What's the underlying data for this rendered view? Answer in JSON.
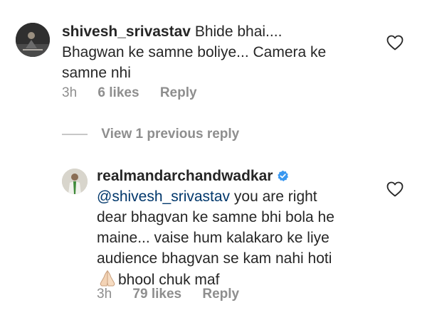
{
  "comments": [
    {
      "username": "shivesh_srivastav",
      "text_line1": "Bhide bhai....",
      "text_line2": "Bhagwan ke samne boliye... Camera ke",
      "text_line3": "samne nhi",
      "time": "3h",
      "likes": "6 likes",
      "reply_label": "Reply",
      "avatar_icon": "user-avatar-dark",
      "liked": false
    },
    {
      "username": "realmandarchandwadkar",
      "verified": true,
      "mention": "@shivesh_srivastav",
      "text_line1": "you are right",
      "text_line2": "dear bhagvan ke samne bhi bola he",
      "text_line3": "maine... vaise hum kalakaro ke liye",
      "text_line4": "audience bhagvan se kam nahi hoti",
      "text_line5": "bhool chuk maf",
      "emoji": "🙏🏻",
      "time": "3h",
      "likes": "79 likes",
      "reply_label": "Reply",
      "avatar_icon": "user-avatar-light",
      "liked": false
    }
  ],
  "view_replies_label": "View 1 previous reply",
  "colors": {
    "text": "#262626",
    "secondary": "#8e8e8e",
    "mention": "#00376b",
    "verified": "#3897f0"
  }
}
